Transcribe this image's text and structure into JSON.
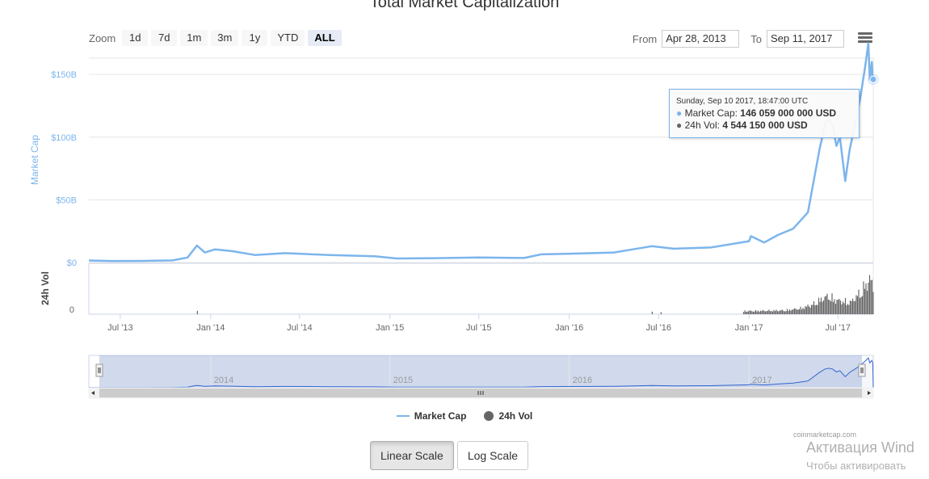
{
  "title": "Total Market Capitalization",
  "zoom": {
    "label": "Zoom",
    "buttons": [
      "1d",
      "7d",
      "1m",
      "3m",
      "1y",
      "YTD",
      "ALL"
    ],
    "active": "ALL"
  },
  "range": {
    "from_label": "From",
    "from_value": "Apr 28, 2013",
    "to_label": "To",
    "to_value": "Sep 11, 2017"
  },
  "menu_icon": "hamburger-menu-icon",
  "tooltip": {
    "date": "Sunday, Sep 10 2017, 18:47:00 UTC",
    "series": [
      {
        "name": "Market Cap",
        "value": "146 059 000 000 USD",
        "color": "#7cb5ec"
      },
      {
        "name": "24h Vol",
        "value": "4 544 150 000 USD",
        "color": "#666666"
      }
    ]
  },
  "legend": [
    {
      "name": "Market Cap",
      "color": "#7cb5ec",
      "symbol": "line"
    },
    {
      "name": "24h Vol",
      "color": "#666666",
      "symbol": "circle"
    }
  ],
  "credit": "coinmarketcap.com",
  "scale_buttons": [
    "Linear Scale",
    "Log Scale"
  ],
  "active_scale": "Linear Scale",
  "watermark": {
    "line1": "Активация Wind",
    "line2": "Чтобы активировать"
  },
  "chart_data": {
    "type": "line",
    "title": "Total Market Capitalization",
    "y_axis_label": "Market Cap",
    "y_ticks": [
      "$0",
      "$50B",
      "$100B",
      "$150B"
    ],
    "y_tick_values": [
      0,
      50,
      100,
      150
    ],
    "ylim": [
      0,
      160
    ],
    "y_units": "billion USD",
    "vol_axis_label": "24h Vol",
    "vol_ticks": [
      "0"
    ],
    "x_ticks": [
      "Jul '13",
      "Jan '14",
      "Jul '14",
      "Jan '15",
      "Jul '15",
      "Jan '16",
      "Jul '16",
      "Jan '17",
      "Jul '17"
    ],
    "x_tick_dates": [
      "2013-07-01",
      "2014-01-01",
      "2014-07-01",
      "2015-01-01",
      "2015-07-01",
      "2016-01-01",
      "2016-07-01",
      "2017-01-01",
      "2017-07-01"
    ],
    "xlim": [
      "2013-04-28",
      "2017-09-11"
    ],
    "navigator_labels": [
      "2014",
      "2015",
      "2016",
      "2017"
    ],
    "navigator_label_dates": [
      "2014-01-01",
      "2015-01-01",
      "2016-01-01",
      "2017-01-01"
    ],
    "grid": true,
    "legend_position": "bottom-center",
    "series": [
      {
        "name": "Market Cap",
        "color": "#7cb5ec",
        "points": [
          [
            "2013-04-28",
            1.6
          ],
          [
            "2013-06-15",
            1.2
          ],
          [
            "2013-08-15",
            1.3
          ],
          [
            "2013-10-15",
            1.7
          ],
          [
            "2013-11-15",
            4.0
          ],
          [
            "2013-12-04",
            13.5
          ],
          [
            "2013-12-20",
            8.0
          ],
          [
            "2014-01-10",
            10.5
          ],
          [
            "2014-02-15",
            9.0
          ],
          [
            "2014-04-01",
            6.0
          ],
          [
            "2014-06-01",
            7.5
          ],
          [
            "2014-09-01",
            6.0
          ],
          [
            "2014-12-01",
            5.0
          ],
          [
            "2015-01-15",
            3.2
          ],
          [
            "2015-04-01",
            3.5
          ],
          [
            "2015-07-01",
            4.0
          ],
          [
            "2015-10-01",
            3.6
          ],
          [
            "2015-11-05",
            6.5
          ],
          [
            "2016-01-01",
            7.0
          ],
          [
            "2016-04-01",
            8.0
          ],
          [
            "2016-06-17",
            13.0
          ],
          [
            "2016-08-01",
            11.0
          ],
          [
            "2016-10-15",
            12.0
          ],
          [
            "2017-01-01",
            17.0
          ],
          [
            "2017-01-05",
            21.0
          ],
          [
            "2017-02-01",
            16.0
          ],
          [
            "2017-03-01",
            22.0
          ],
          [
            "2017-04-01",
            27.0
          ],
          [
            "2017-05-01",
            40.0
          ],
          [
            "2017-05-25",
            91.0
          ],
          [
            "2017-06-05",
            110.0
          ],
          [
            "2017-06-12",
            114.0
          ],
          [
            "2017-06-20",
            110.0
          ],
          [
            "2017-06-28",
            93.0
          ],
          [
            "2017-07-05",
            100.0
          ],
          [
            "2017-07-16",
            65.0
          ],
          [
            "2017-07-25",
            90.0
          ],
          [
            "2017-08-05",
            110.0
          ],
          [
            "2017-08-15",
            130.0
          ],
          [
            "2017-08-25",
            155.0
          ],
          [
            "2017-09-01",
            175.0
          ],
          [
            "2017-09-04",
            146.0
          ],
          [
            "2017-09-08",
            160.0
          ],
          [
            "2017-09-10",
            146.06
          ]
        ]
      },
      {
        "name": "24h Vol",
        "color": "#666666",
        "points": [
          [
            "2013-12-04",
            0.4
          ],
          [
            "2016-06-17",
            0.3
          ],
          [
            "2017-01-05",
            0.5
          ],
          [
            "2017-03-15",
            0.6
          ],
          [
            "2017-04-15",
            0.9
          ],
          [
            "2017-05-10",
            1.5
          ],
          [
            "2017-05-25",
            2.2
          ],
          [
            "2017-06-10",
            2.8
          ],
          [
            "2017-06-25",
            2.2
          ],
          [
            "2017-07-10",
            2.0
          ],
          [
            "2017-07-25",
            1.8
          ],
          [
            "2017-08-05",
            2.6
          ],
          [
            "2017-08-18",
            3.6
          ],
          [
            "2017-09-02",
            5.4
          ],
          [
            "2017-09-10",
            4.54
          ]
        ]
      }
    ]
  }
}
